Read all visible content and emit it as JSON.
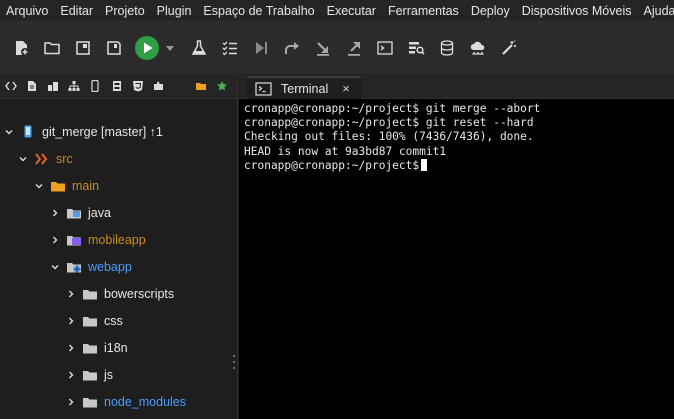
{
  "menu": [
    "Arquivo",
    "Editar",
    "Projeto",
    "Plugin",
    "Espaço de Trabalho",
    "Executar",
    "Ferramentas",
    "Deploy",
    "Dispositivos Móveis",
    "Ajuda"
  ],
  "toolbar": {
    "icons": [
      "new-file-icon",
      "open-folder-icon",
      "window-icon",
      "save-icon",
      "run-icon",
      "dropdown-icon",
      "test-flask-icon",
      "checklist-icon",
      "step-forward-icon",
      "share-icon",
      "download-icon",
      "export-icon",
      "terminal-icon",
      "database-search-icon",
      "database-icon",
      "cloud-icon",
      "magic-wand-icon"
    ],
    "run_color": "#2ea043"
  },
  "left_tabs": [
    "code-icon",
    "file-icon",
    "blocks-icon",
    "sitemap-icon",
    "mobile-icon",
    "form-icon",
    "html5-icon",
    "puzzle-icon",
    "folder-tab-icon",
    "star-icon"
  ],
  "tree": [
    {
      "label": "git_merge [master] ↑1",
      "icon": "project-icon",
      "style": "white",
      "expanded": true
    },
    {
      "label": "src",
      "icon": "source-icon",
      "style": "orange",
      "expanded": true
    },
    {
      "label": "main",
      "icon": "folder-orange-icon",
      "style": "orange",
      "expanded": true
    },
    {
      "label": "java",
      "icon": "java-folder-icon",
      "style": "white",
      "expanded": false
    },
    {
      "label": "mobileapp",
      "icon": "mobile-folder-icon",
      "style": "orange",
      "expanded": false
    },
    {
      "label": "webapp",
      "icon": "web-folder-icon",
      "style": "blue",
      "expanded": true
    },
    {
      "label": "bowerscripts",
      "icon": "folder-icon",
      "style": "white",
      "expanded": false
    },
    {
      "label": "css",
      "icon": "folder-icon",
      "style": "white",
      "expanded": false
    },
    {
      "label": "i18n",
      "icon": "folder-icon",
      "style": "white",
      "expanded": false
    },
    {
      "label": "js",
      "icon": "folder-icon",
      "style": "white",
      "expanded": false
    },
    {
      "label": "node_modules",
      "icon": "folder-icon",
      "style": "blue",
      "expanded": false
    }
  ],
  "terminal": {
    "tab_label": "Terminal",
    "close_label": "×",
    "lines": [
      "cronapp@cronapp:~/project$ git merge --abort",
      "cronapp@cronapp:~/project$ git reset --hard",
      "Checking out files: 100% (7436/7436), done.",
      "HEAD is now at 9a3bd87 commit1",
      "cronapp@cronapp:~/project$"
    ]
  },
  "colors": {
    "folder_orange": "#f0a020",
    "folder_grey": "#c8c8c8",
    "accent_blue": "#4a9eff",
    "label_orange": "#c98a1e"
  }
}
